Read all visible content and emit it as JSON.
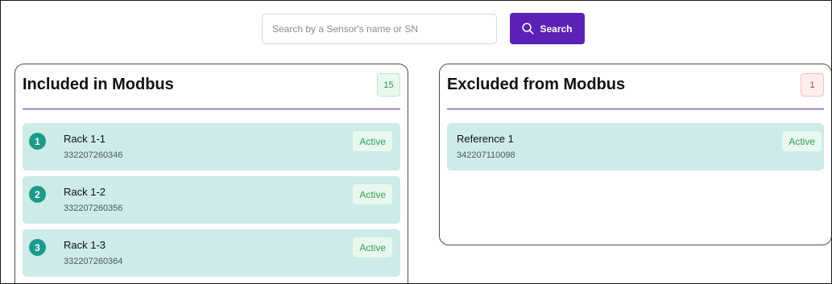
{
  "search": {
    "placeholder": "Search by a Sensor's name or SN",
    "button_label": "Search",
    "button_icon": "search-icon"
  },
  "colors": {
    "accent": "#5b21b6",
    "item_bg": "#cdebe8",
    "number_badge": "#1c9a8b",
    "active_text": "#2ea05a"
  },
  "included": {
    "title": "Included in Modbus",
    "count": "15",
    "items": [
      {
        "number": "1",
        "name": "Rack 1-1",
        "sn": "332207260346",
        "status": "Active"
      },
      {
        "number": "2",
        "name": "Rack 1-2",
        "sn": "332207260356",
        "status": "Active"
      },
      {
        "number": "3",
        "name": "Rack 1-3",
        "sn": "332207260364",
        "status": "Active"
      }
    ]
  },
  "excluded": {
    "title": "Excluded from Modbus",
    "count": "1",
    "items": [
      {
        "name": "Reference 1",
        "sn": "342207110098",
        "status": "Active"
      }
    ]
  }
}
